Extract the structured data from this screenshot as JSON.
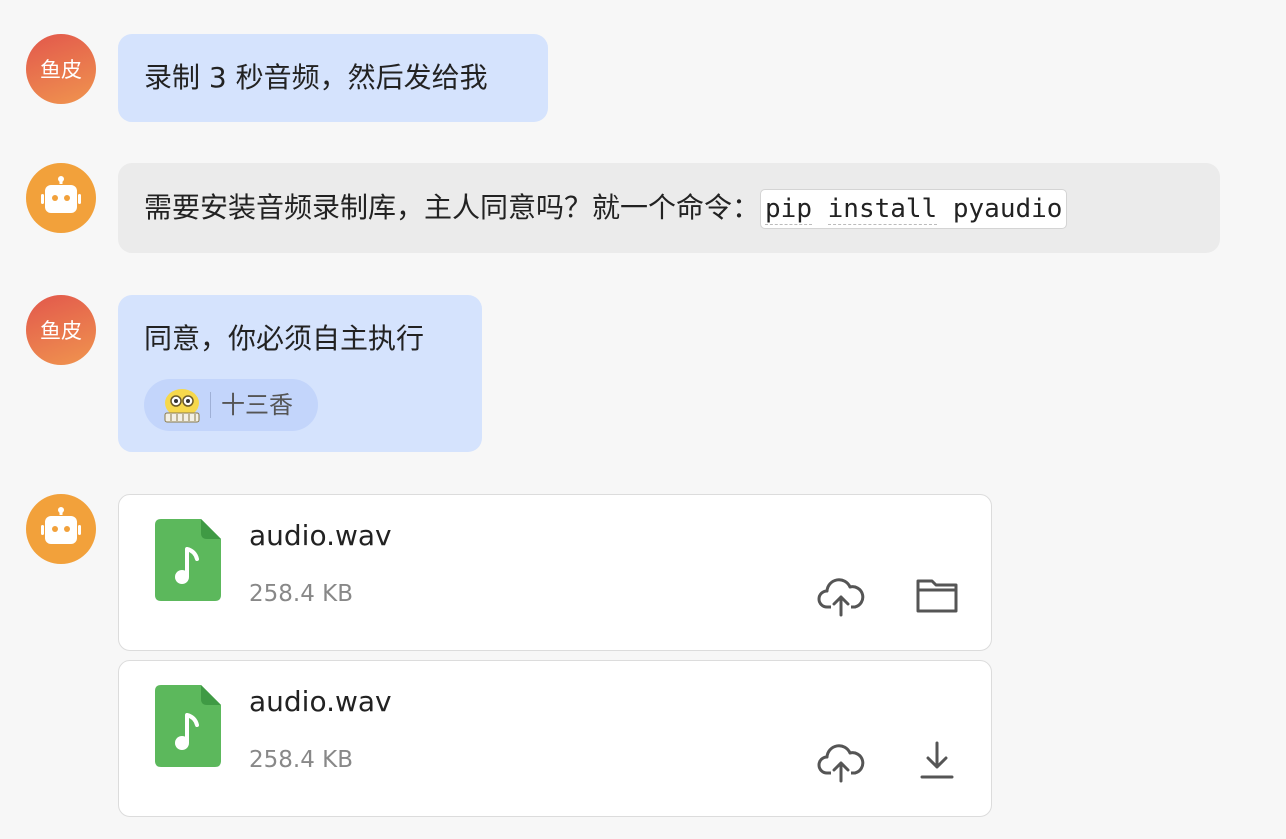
{
  "messages": [
    {
      "sender": "user",
      "avatar_text": "鱼皮",
      "text": "录制 3 秒音频，然后发给我"
    },
    {
      "sender": "bot",
      "avatar_icon": "robot-icon",
      "text_prefix": "需要安装音频录制库，主人同意吗？就一个命令：",
      "code_tokens": [
        "pip",
        "install",
        "pyaudio"
      ]
    },
    {
      "sender": "user",
      "avatar_text": "鱼皮",
      "text": "同意，你必须自主执行",
      "reaction": {
        "icon": "emoji-sticker-icon",
        "label": "十三香"
      }
    }
  ],
  "files": [
    {
      "name": "audio.wav",
      "size": "258.4 KB",
      "icon": "audio-file-icon",
      "actions": [
        "cloud-upload-icon",
        "folder-icon"
      ]
    },
    {
      "name": "audio.wav",
      "size": "258.4 KB",
      "icon": "audio-file-icon",
      "actions": [
        "cloud-upload-icon",
        "download-icon"
      ]
    }
  ],
  "colors": {
    "user_bubble": "#d5e3fd",
    "bot_bubble": "#ebebeb",
    "user_avatar": "#e2574c",
    "bot_avatar": "#f2a13b",
    "file_icon": "#5cb85c"
  }
}
